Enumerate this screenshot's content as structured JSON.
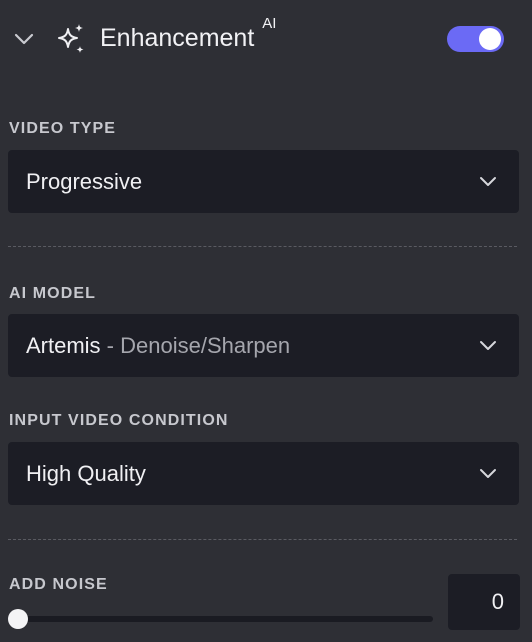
{
  "header": {
    "title": "Enhancement",
    "badge": "AI",
    "toggle_on": true,
    "accent_color": "#6b6af5",
    "collapse_icon": "chevron-down-icon",
    "title_icon": "sparkle-icon"
  },
  "video_type": {
    "label": "VIDEO TYPE",
    "value": "Progressive"
  },
  "ai_model": {
    "label": "AI MODEL",
    "value": "Artemis",
    "separator": " - ",
    "secondary": "Denoise/Sharpen"
  },
  "input_condition": {
    "label": "INPUT VIDEO CONDITION",
    "value": "High Quality"
  },
  "add_noise": {
    "label": "ADD NOISE",
    "value": "0",
    "slider_fraction": 0
  }
}
